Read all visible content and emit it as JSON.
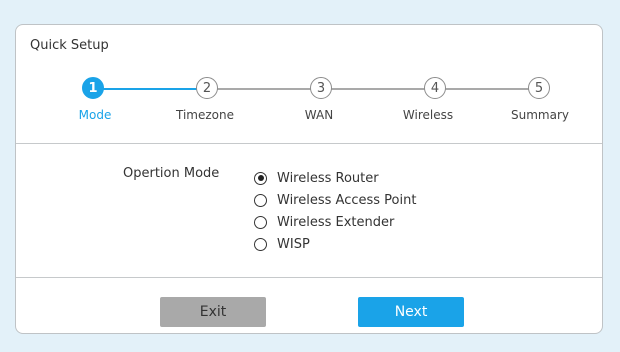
{
  "panel": {
    "title": "Quick Setup"
  },
  "steps": [
    {
      "number": "1",
      "label": "Mode",
      "active": true
    },
    {
      "number": "2",
      "label": "Timezone",
      "active": false
    },
    {
      "number": "3",
      "label": "WAN",
      "active": false
    },
    {
      "number": "4",
      "label": "Wireless",
      "active": false
    },
    {
      "number": "5",
      "label": "Summary",
      "active": false
    }
  ],
  "operation_mode": {
    "label": "Opertion Mode",
    "options": [
      {
        "label": "Wireless Router",
        "checked": true
      },
      {
        "label": "Wireless Access Point",
        "checked": false
      },
      {
        "label": "Wireless Extender",
        "checked": false
      },
      {
        "label": "WISP",
        "checked": false
      }
    ]
  },
  "buttons": {
    "exit": "Exit",
    "next": "Next"
  },
  "colors": {
    "accent": "#1aa3e8",
    "background": "#e3f1f9",
    "exit_button": "#a9a9a9"
  }
}
